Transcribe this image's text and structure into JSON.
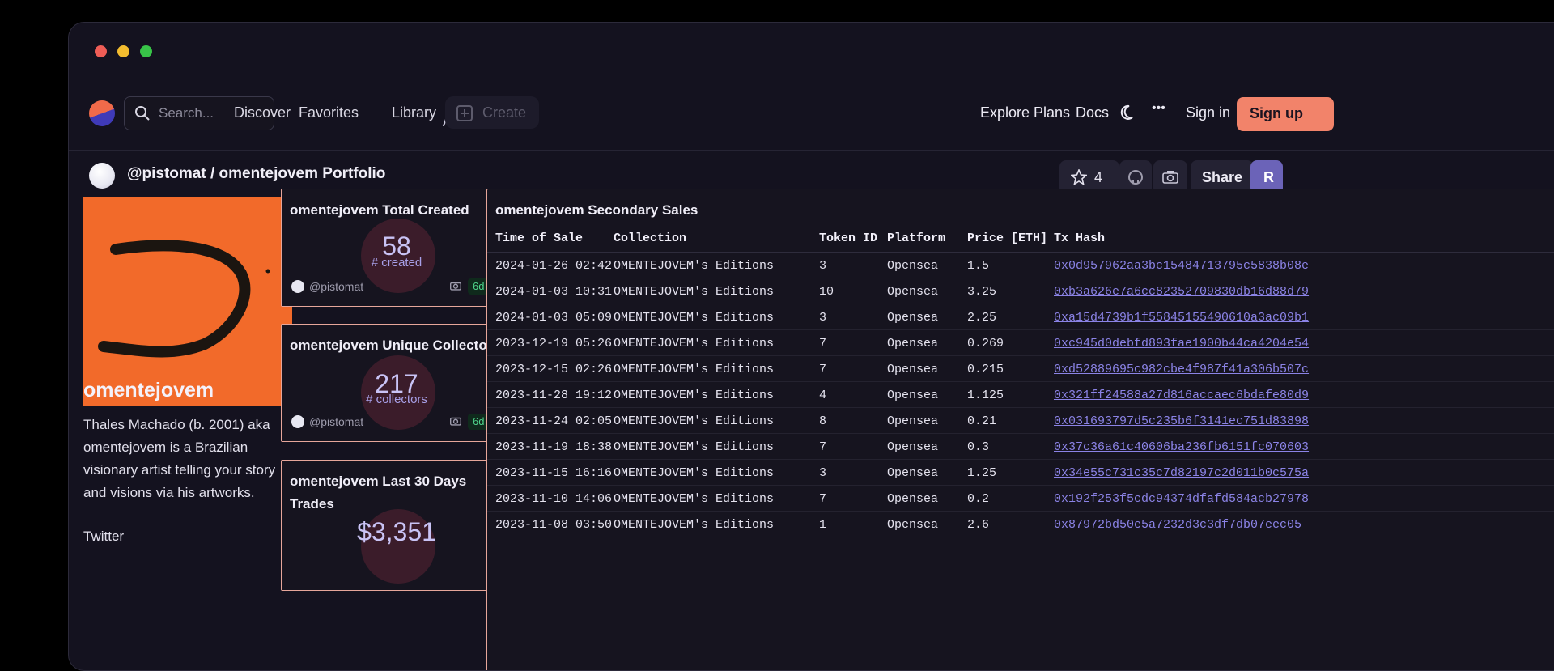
{
  "nav": {
    "search_placeholder": "Search...",
    "discover": "Discover",
    "favorites": "Favorites",
    "library": "Library",
    "create": "Create",
    "explore_plans": "Explore Plans",
    "docs": "Docs",
    "more": "•••",
    "sign_in": "Sign in",
    "sign_up": "Sign up"
  },
  "page": {
    "title": "@pistomat / omentejovem Portfolio",
    "star_count": "4",
    "share": "Share",
    "run": "R"
  },
  "artist": {
    "name": "omentejovem",
    "bio": "Thales Machado (b. 2001) aka omentejovem is a Brazilian visionary artist telling your story and visions via his artworks.",
    "twitter": "Twitter"
  },
  "cards": [
    {
      "title": "omentejovem Total Created",
      "value": "58",
      "unit": "# created",
      "user": "@pistomat",
      "age": "6d"
    },
    {
      "title": "omentejovem Unique Collectors",
      "value": "217",
      "unit": "# collectors",
      "user": "@pistomat",
      "age": "6d"
    },
    {
      "title": "omentejovem Last 30 Days Trades",
      "value": "$3,351",
      "unit": ""
    }
  ],
  "sales": {
    "title": "omentejovem Secondary Sales",
    "columns": [
      "Time of Sale",
      "Collection",
      "Token ID",
      "Platform",
      "Price [ETH]",
      "Tx Hash"
    ],
    "rows": [
      [
        "2024-01-26 02:42",
        "OMENTEJOVEM's Editions",
        "3",
        "Opensea",
        "1.5",
        "0x0d957962aa3bc15484713795c5838b08e"
      ],
      [
        "2024-01-03 10:31",
        "OMENTEJOVEM's Editions",
        "10",
        "Opensea",
        "3.25",
        "0xb3a626e7a6cc82352709830db16d88d79"
      ],
      [
        "2024-01-03 05:09",
        "OMENTEJOVEM's Editions",
        "3",
        "Opensea",
        "2.25",
        "0xa15d4739b1f55845155490610a3ac09b1"
      ],
      [
        "2023-12-19 05:26",
        "OMENTEJOVEM's Editions",
        "7",
        "Opensea",
        "0.269",
        "0xc945d0debfd893fae1900b44ca4204e54"
      ],
      [
        "2023-12-15 02:26",
        "OMENTEJOVEM's Editions",
        "7",
        "Opensea",
        "0.215",
        "0xd52889695c982cbe4f987f41a306b507c"
      ],
      [
        "2023-11-28 19:12",
        "OMENTEJOVEM's Editions",
        "4",
        "Opensea",
        "1.125",
        "0x321ff24588a27d816accaec6bdafe80d9"
      ],
      [
        "2023-11-24 02:05",
        "OMENTEJOVEM's Editions",
        "8",
        "Opensea",
        "0.21",
        "0x031693797d5c235b6f3141ec751d83898"
      ],
      [
        "2023-11-19 18:38",
        "OMENTEJOVEM's Editions",
        "7",
        "Opensea",
        "0.3",
        "0x37c36a61c40606ba236fb6151fc070603"
      ],
      [
        "2023-11-15 16:16",
        "OMENTEJOVEM's Editions",
        "3",
        "Opensea",
        "1.25",
        "0x34e55c731c35c7d82197c2d011b0c575a"
      ],
      [
        "2023-11-10 14:06",
        "OMENTEJOVEM's Editions",
        "7",
        "Opensea",
        "0.2",
        "0x192f253f5cdc94374dfafd584acb27978"
      ],
      [
        "2023-11-08 03:50",
        "OMENTEJOVEM's Editions",
        "1",
        "Opensea",
        "2.6",
        "0x87972bd50e5a7232d3c3df7db07eec05"
      ]
    ]
  }
}
